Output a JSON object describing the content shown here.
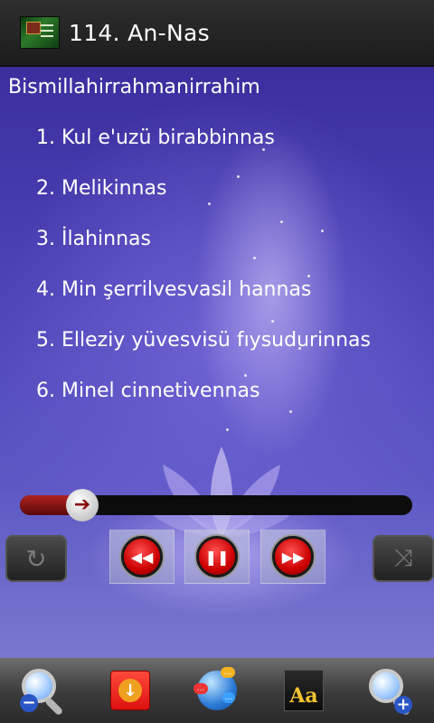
{
  "app": {
    "title": "114. An-Nas",
    "icon": "quran-book-icon"
  },
  "content": {
    "bismillah": "Bismillahirrahmanirrahim",
    "verses": [
      "1. Kul e'uzü birabbinnas",
      "2. Melikinnas",
      "3. İlahinnas",
      "4. Min şerrilvesvasil hannas",
      "5. Elleziy yüvesvisü fıysudurinnas",
      "6. Minel cinnetivennas"
    ]
  },
  "player": {
    "progress": 0.16,
    "repeat_icon": "repeat-icon",
    "rewind_icon": "rewind-icon",
    "pause_icon": "pause-icon",
    "forward_icon": "fast-forward-icon",
    "shuffle_icon": "shuffle-icon",
    "accent": "#c00000"
  },
  "toolbar": {
    "zoom_out_icon": "zoom-out-icon",
    "download_icon": "download-icon",
    "share_icon": "share-globe-icon",
    "font_label": "Aa",
    "zoom_in_icon": "zoom-in-icon"
  }
}
